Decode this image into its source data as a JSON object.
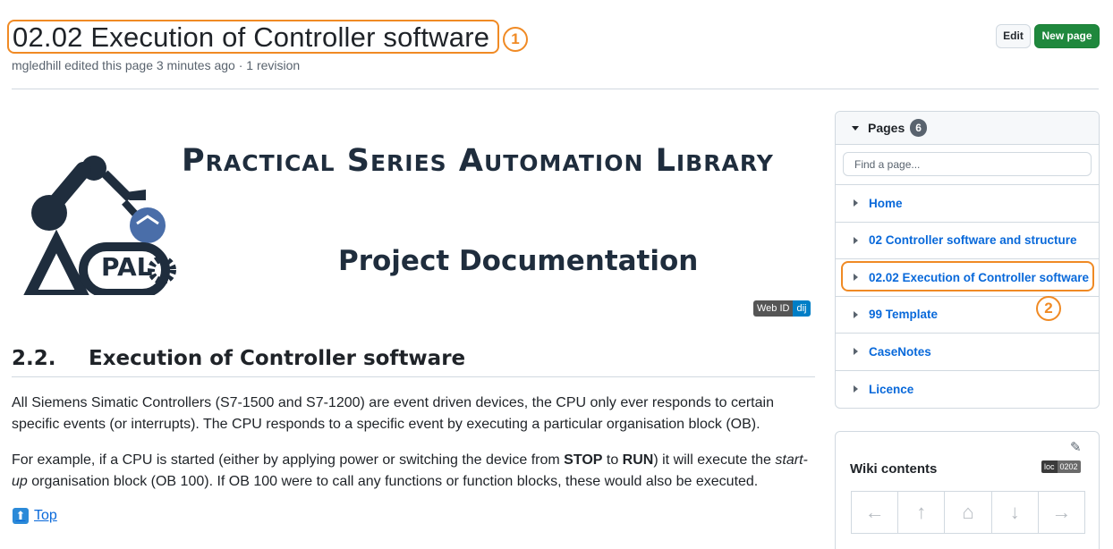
{
  "header": {
    "title": "02.02 Execution of Controller software",
    "subtitle": "mgledhill edited this page 3 minutes ago · 1 revision",
    "marker_1": "1",
    "edit_label": "Edit",
    "new_page_label": "New page"
  },
  "banner": {
    "heading": "Practical Series Automation Library",
    "subheading": "Project Documentation",
    "logo_text": "PAL",
    "badge_label": "Web ID",
    "badge_value": "dij"
  },
  "content": {
    "section_number": "2.2.",
    "section_title": "Execution of Controller software",
    "paragraph_1": "All Siemens Simatic Controllers (S7-1500 and S7-1200) are event driven devices, the CPU only ever responds to certain specific events (or interrupts). The CPU responds to a specific event by executing a particular organisation block (OB).",
    "paragraph_2_part_1": "For example, if a CPU is started (either by applying power or switching the device from ",
    "paragraph_2_stop": "STOP",
    "paragraph_2_to": " to ",
    "paragraph_2_run": "RUN",
    "paragraph_2_part_2": ") it will execute the ",
    "paragraph_2_startup": "start-up",
    "paragraph_2_part_3": " organisation block (OB 100). If OB 100 were to call any functions or function blocks, these would also be executed.",
    "top_icon": "⬆",
    "top_link": "Top"
  },
  "sidebar": {
    "pages_label": "Pages",
    "pages_count": "6",
    "find_placeholder": "Find a page...",
    "pages": [
      {
        "label": "Home"
      },
      {
        "label": "02 Controller software and structure"
      },
      {
        "label": "02.02 Execution of Controller software"
      },
      {
        "label": "99 Template"
      },
      {
        "label": "CaseNotes"
      },
      {
        "label": "Licence"
      }
    ],
    "marker_2": "2",
    "contents_title": "Wiki contents",
    "loc_label": "loc",
    "loc_value": "0202",
    "nav": {
      "prev": "←",
      "up": "↑",
      "home": "⌂",
      "down": "↓",
      "next": "→"
    }
  },
  "colors": {
    "accent_orange": "#f08a24",
    "link_blue": "#0969da",
    "new_page_green": "#1f883d",
    "logo_navy": "#1f2d3d",
    "logo_blue": "#4a6ea9"
  }
}
